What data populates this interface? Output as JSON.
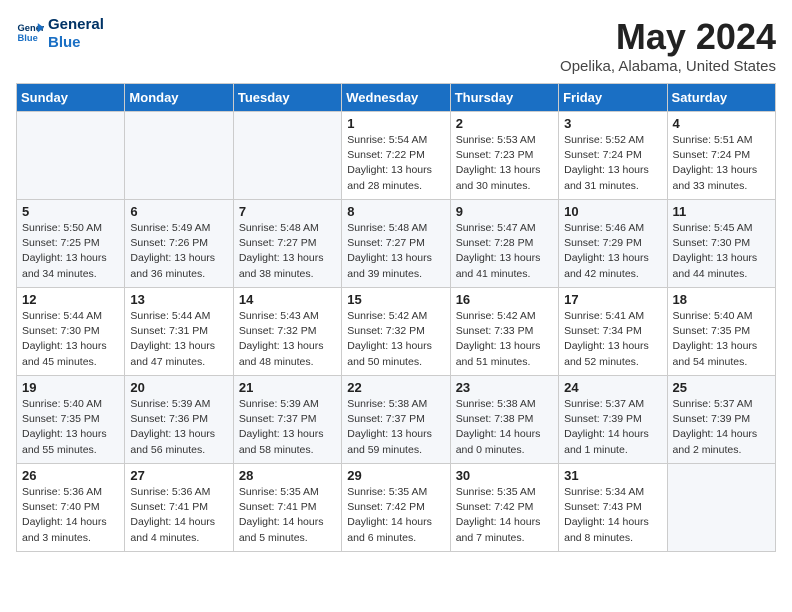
{
  "logo": {
    "line1": "General",
    "line2": "Blue"
  },
  "title": "May 2024",
  "subtitle": "Opelika, Alabama, United States",
  "days_of_week": [
    "Sunday",
    "Monday",
    "Tuesday",
    "Wednesday",
    "Thursday",
    "Friday",
    "Saturday"
  ],
  "weeks": [
    [
      {
        "day": "",
        "sunrise": "",
        "sunset": "",
        "daylight": ""
      },
      {
        "day": "",
        "sunrise": "",
        "sunset": "",
        "daylight": ""
      },
      {
        "day": "",
        "sunrise": "",
        "sunset": "",
        "daylight": ""
      },
      {
        "day": "1",
        "sunrise": "Sunrise: 5:54 AM",
        "sunset": "Sunset: 7:22 PM",
        "daylight": "Daylight: 13 hours and 28 minutes."
      },
      {
        "day": "2",
        "sunrise": "Sunrise: 5:53 AM",
        "sunset": "Sunset: 7:23 PM",
        "daylight": "Daylight: 13 hours and 30 minutes."
      },
      {
        "day": "3",
        "sunrise": "Sunrise: 5:52 AM",
        "sunset": "Sunset: 7:24 PM",
        "daylight": "Daylight: 13 hours and 31 minutes."
      },
      {
        "day": "4",
        "sunrise": "Sunrise: 5:51 AM",
        "sunset": "Sunset: 7:24 PM",
        "daylight": "Daylight: 13 hours and 33 minutes."
      }
    ],
    [
      {
        "day": "5",
        "sunrise": "Sunrise: 5:50 AM",
        "sunset": "Sunset: 7:25 PM",
        "daylight": "Daylight: 13 hours and 34 minutes."
      },
      {
        "day": "6",
        "sunrise": "Sunrise: 5:49 AM",
        "sunset": "Sunset: 7:26 PM",
        "daylight": "Daylight: 13 hours and 36 minutes."
      },
      {
        "day": "7",
        "sunrise": "Sunrise: 5:48 AM",
        "sunset": "Sunset: 7:27 PM",
        "daylight": "Daylight: 13 hours and 38 minutes."
      },
      {
        "day": "8",
        "sunrise": "Sunrise: 5:48 AM",
        "sunset": "Sunset: 7:27 PM",
        "daylight": "Daylight: 13 hours and 39 minutes."
      },
      {
        "day": "9",
        "sunrise": "Sunrise: 5:47 AM",
        "sunset": "Sunset: 7:28 PM",
        "daylight": "Daylight: 13 hours and 41 minutes."
      },
      {
        "day": "10",
        "sunrise": "Sunrise: 5:46 AM",
        "sunset": "Sunset: 7:29 PM",
        "daylight": "Daylight: 13 hours and 42 minutes."
      },
      {
        "day": "11",
        "sunrise": "Sunrise: 5:45 AM",
        "sunset": "Sunset: 7:30 PM",
        "daylight": "Daylight: 13 hours and 44 minutes."
      }
    ],
    [
      {
        "day": "12",
        "sunrise": "Sunrise: 5:44 AM",
        "sunset": "Sunset: 7:30 PM",
        "daylight": "Daylight: 13 hours and 45 minutes."
      },
      {
        "day": "13",
        "sunrise": "Sunrise: 5:44 AM",
        "sunset": "Sunset: 7:31 PM",
        "daylight": "Daylight: 13 hours and 47 minutes."
      },
      {
        "day": "14",
        "sunrise": "Sunrise: 5:43 AM",
        "sunset": "Sunset: 7:32 PM",
        "daylight": "Daylight: 13 hours and 48 minutes."
      },
      {
        "day": "15",
        "sunrise": "Sunrise: 5:42 AM",
        "sunset": "Sunset: 7:32 PM",
        "daylight": "Daylight: 13 hours and 50 minutes."
      },
      {
        "day": "16",
        "sunrise": "Sunrise: 5:42 AM",
        "sunset": "Sunset: 7:33 PM",
        "daylight": "Daylight: 13 hours and 51 minutes."
      },
      {
        "day": "17",
        "sunrise": "Sunrise: 5:41 AM",
        "sunset": "Sunset: 7:34 PM",
        "daylight": "Daylight: 13 hours and 52 minutes."
      },
      {
        "day": "18",
        "sunrise": "Sunrise: 5:40 AM",
        "sunset": "Sunset: 7:35 PM",
        "daylight": "Daylight: 13 hours and 54 minutes."
      }
    ],
    [
      {
        "day": "19",
        "sunrise": "Sunrise: 5:40 AM",
        "sunset": "Sunset: 7:35 PM",
        "daylight": "Daylight: 13 hours and 55 minutes."
      },
      {
        "day": "20",
        "sunrise": "Sunrise: 5:39 AM",
        "sunset": "Sunset: 7:36 PM",
        "daylight": "Daylight: 13 hours and 56 minutes."
      },
      {
        "day": "21",
        "sunrise": "Sunrise: 5:39 AM",
        "sunset": "Sunset: 7:37 PM",
        "daylight": "Daylight: 13 hours and 58 minutes."
      },
      {
        "day": "22",
        "sunrise": "Sunrise: 5:38 AM",
        "sunset": "Sunset: 7:37 PM",
        "daylight": "Daylight: 13 hours and 59 minutes."
      },
      {
        "day": "23",
        "sunrise": "Sunrise: 5:38 AM",
        "sunset": "Sunset: 7:38 PM",
        "daylight": "Daylight: 14 hours and 0 minutes."
      },
      {
        "day": "24",
        "sunrise": "Sunrise: 5:37 AM",
        "sunset": "Sunset: 7:39 PM",
        "daylight": "Daylight: 14 hours and 1 minute."
      },
      {
        "day": "25",
        "sunrise": "Sunrise: 5:37 AM",
        "sunset": "Sunset: 7:39 PM",
        "daylight": "Daylight: 14 hours and 2 minutes."
      }
    ],
    [
      {
        "day": "26",
        "sunrise": "Sunrise: 5:36 AM",
        "sunset": "Sunset: 7:40 PM",
        "daylight": "Daylight: 14 hours and 3 minutes."
      },
      {
        "day": "27",
        "sunrise": "Sunrise: 5:36 AM",
        "sunset": "Sunset: 7:41 PM",
        "daylight": "Daylight: 14 hours and 4 minutes."
      },
      {
        "day": "28",
        "sunrise": "Sunrise: 5:35 AM",
        "sunset": "Sunset: 7:41 PM",
        "daylight": "Daylight: 14 hours and 5 minutes."
      },
      {
        "day": "29",
        "sunrise": "Sunrise: 5:35 AM",
        "sunset": "Sunset: 7:42 PM",
        "daylight": "Daylight: 14 hours and 6 minutes."
      },
      {
        "day": "30",
        "sunrise": "Sunrise: 5:35 AM",
        "sunset": "Sunset: 7:42 PM",
        "daylight": "Daylight: 14 hours and 7 minutes."
      },
      {
        "day": "31",
        "sunrise": "Sunrise: 5:34 AM",
        "sunset": "Sunset: 7:43 PM",
        "daylight": "Daylight: 14 hours and 8 minutes."
      },
      {
        "day": "",
        "sunrise": "",
        "sunset": "",
        "daylight": ""
      }
    ]
  ]
}
